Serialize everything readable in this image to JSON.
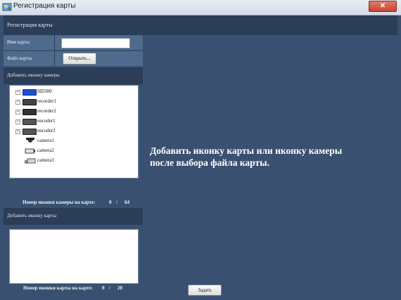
{
  "window": {
    "title": "Регистрация карты",
    "close_glyph": "✕"
  },
  "header": {
    "title": "Регистрация карты"
  },
  "form": {
    "map_name_label": "Имя карты",
    "map_name_value": "",
    "map_file_label": "Файл карты",
    "open_button": "Открыть..."
  },
  "camera_section": {
    "title": "Добавить иконку камеры",
    "tree": [
      {
        "label": "HD300",
        "icon": "device-blue-icon",
        "expandable": true
      },
      {
        "label": "recorder1",
        "icon": "recorder-icon",
        "expandable": true
      },
      {
        "label": "recorder2",
        "icon": "recorder-icon",
        "expandable": true
      },
      {
        "label": "encoder1",
        "icon": "encoder-icon",
        "expandable": true
      },
      {
        "label": "encoder2",
        "icon": "encoder-icon",
        "expandable": true
      },
      {
        "label": "camera1",
        "icon": "dome-camera-icon",
        "expandable": false
      },
      {
        "label": "camera2",
        "icon": "box-camera-icon",
        "expandable": false
      },
      {
        "label": "camera3",
        "icon": "camera-bracket-icon",
        "expandable": false
      }
    ],
    "count_label": "Номер иконки камеры на карте:",
    "count_value": "0",
    "count_sep": "/",
    "count_max": "64"
  },
  "map_section": {
    "title": "Добавить иконку карты",
    "count_label": "Номер иконки карты на карте:",
    "count_value": "0",
    "count_sep": "/",
    "count_max": "20"
  },
  "main": {
    "message_line1": "Добавить иконку карты или иконку камеры",
    "message_line2": "после выбора файла карты."
  },
  "footer": {
    "apply_button": "Задать"
  },
  "colors": {
    "background": "#3a5070",
    "band": "#2b3d57",
    "row": "#4e6a8c"
  }
}
